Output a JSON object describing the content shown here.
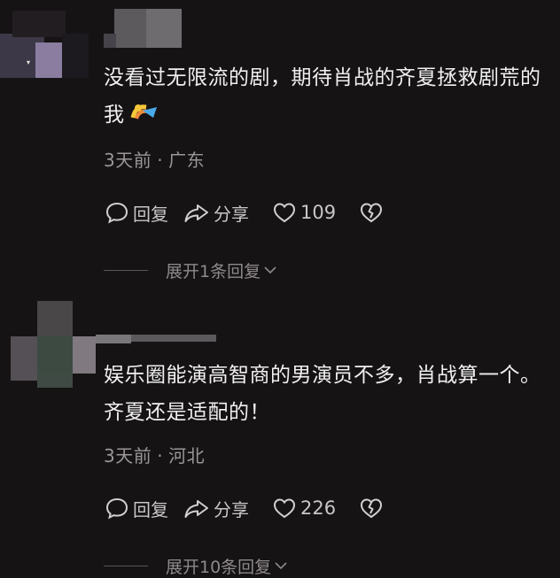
{
  "comments": [
    {
      "text": "没看过无限流的剧，期待肖战的齐夏拯救剧荒的我",
      "emoji": "🌈",
      "time": "3天前",
      "location": "广东",
      "reply_label": "回复",
      "share_label": "分享",
      "likes": "109",
      "expand_label": "展开1条回复"
    },
    {
      "text": "娱乐圈能演高智商的男演员不多，肖战算一个。齐夏还是适配的！",
      "time": "3天前",
      "location": "河北",
      "reply_label": "回复",
      "share_label": "分享",
      "likes": "226",
      "expand_label": "展开10条回复"
    }
  ],
  "colors": {
    "background": "#161314",
    "text": "#f0f0f0",
    "meta": "#9a9699",
    "action": "#c9c6c8"
  }
}
